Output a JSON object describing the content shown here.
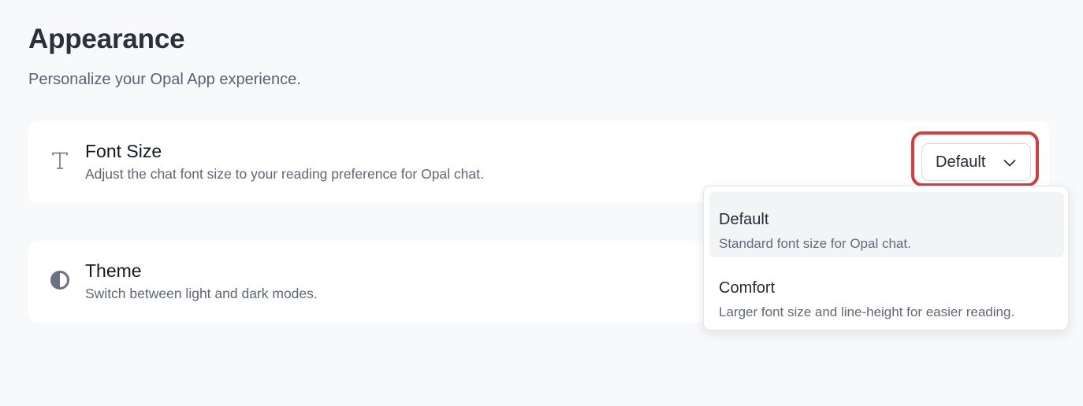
{
  "page": {
    "title": "Appearance",
    "subtitle": "Personalize your Opal App experience."
  },
  "settings": {
    "font_size": {
      "icon": "text-icon",
      "title": "Font Size",
      "description": "Adjust the chat font size to your reading preference for Opal chat.",
      "selected": "Default"
    },
    "theme": {
      "icon": "contrast-icon",
      "title": "Theme",
      "description": "Switch between light and dark modes."
    }
  },
  "dropdown": {
    "options": [
      {
        "label": "Default",
        "description": "Standard font size for Opal chat.",
        "selected": true
      },
      {
        "label": "Comfort",
        "description": "Larger font size and line-height for easier reading.",
        "selected": false
      }
    ]
  },
  "colors": {
    "background": "#f8f9fb",
    "card": "#ffffff",
    "highlight": "#d63c3c",
    "icon": "#6b7180"
  }
}
